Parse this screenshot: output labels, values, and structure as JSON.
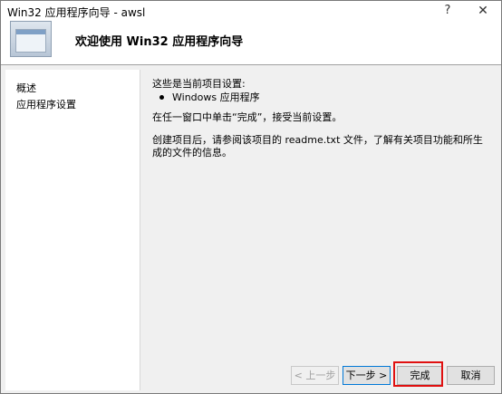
{
  "window": {
    "title": "Win32 应用程序向导 - awsl",
    "help_glyph": "?",
    "close_glyph": "✕"
  },
  "header": {
    "title": "欢迎使用 Win32 应用程序向导"
  },
  "sidebar": {
    "items": [
      {
        "label": "概述"
      },
      {
        "label": "应用程序设置"
      }
    ]
  },
  "content": {
    "intro": "这些是当前项目设置:",
    "bullet": "Windows 应用程序",
    "click_finish": "在任一窗口中单击“完成”，接受当前设置。",
    "after_creation": "创建项目后，请参阅该项目的 readme.txt 文件，了解有关项目功能和所生成的文件的信息。"
  },
  "buttons": {
    "back": "< 上一步",
    "next": "下一步 >",
    "finish": "完成",
    "cancel": "取消"
  },
  "colors": {
    "highlight": "#e01010",
    "focus": "#0078d7"
  }
}
